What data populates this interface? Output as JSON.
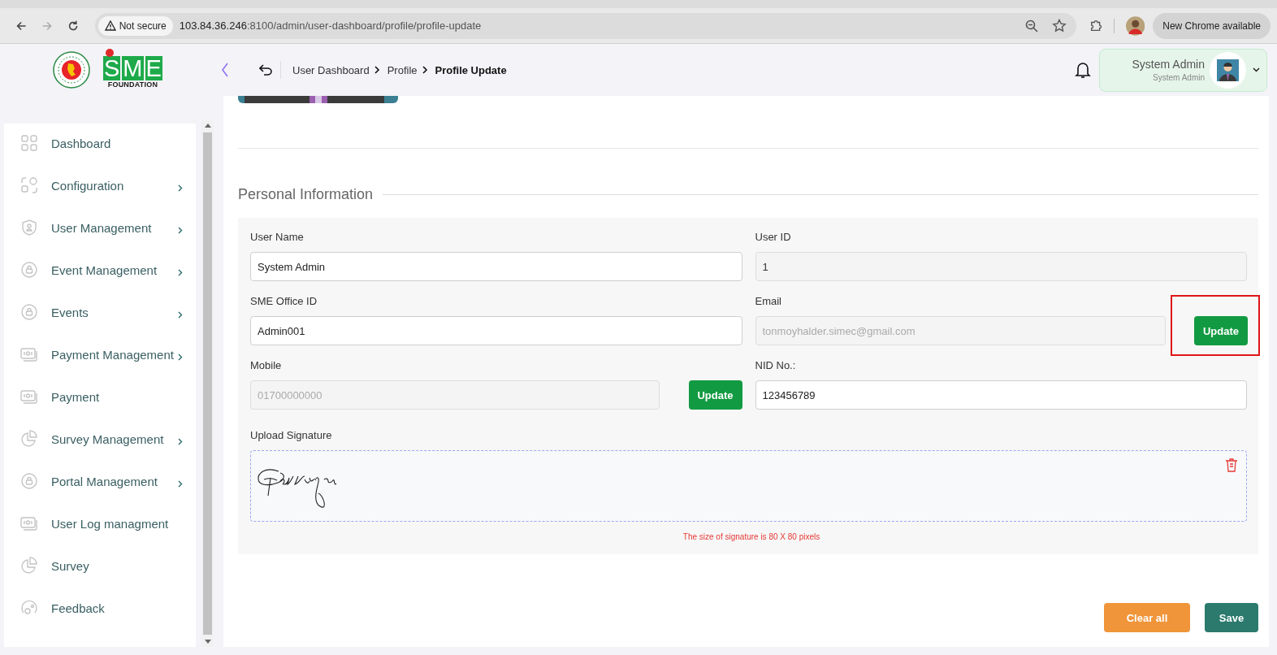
{
  "browser": {
    "security_label": "Not secure",
    "url_host": "103.84.36.246",
    "url_path": ":8100/admin/user-dashboard/profile/profile-update",
    "update_label": "New Chrome available"
  },
  "brand": {
    "mark": "SME",
    "subtitle": "FOUNDATION"
  },
  "header": {
    "breadcrumb": [
      {
        "label": "User Dashboard",
        "current": false
      },
      {
        "label": "Profile",
        "current": false
      },
      {
        "label": "Profile Update",
        "current": true
      }
    ],
    "user": {
      "name": "System Admin",
      "role": "System Admin"
    }
  },
  "sidebar": {
    "items": [
      {
        "label": "Dashboard",
        "has_submenu": false
      },
      {
        "label": "Configuration",
        "has_submenu": true
      },
      {
        "label": "User Management",
        "has_submenu": true
      },
      {
        "label": "Event Management",
        "has_submenu": true
      },
      {
        "label": "Events",
        "has_submenu": true
      },
      {
        "label": "Payment Management",
        "has_submenu": true
      },
      {
        "label": "Payment",
        "has_submenu": false
      },
      {
        "label": "Survey Management",
        "has_submenu": true
      },
      {
        "label": "Portal Management",
        "has_submenu": true
      },
      {
        "label": "User Log managment",
        "has_submenu": false
      },
      {
        "label": "Survey",
        "has_submenu": false
      },
      {
        "label": "Feedback",
        "has_submenu": false
      }
    ]
  },
  "section_title": "Personal Information",
  "fields": [
    {
      "label": "User Name",
      "value": "System Admin",
      "disabled": false
    },
    {
      "label": "User ID",
      "value": "1",
      "disabled": true
    },
    {
      "label": "SME Office ID",
      "value": "Admin001",
      "disabled": false
    },
    {
      "label": "Email",
      "placeholder": "tonmoyhalder.simec@gmail.com",
      "disabled": true,
      "button": {
        "label": "Update",
        "highlighted": true
      }
    },
    {
      "label": "Mobile",
      "placeholder": "01700000000",
      "disabled": true,
      "button": {
        "label": "Update",
        "highlighted": false
      }
    },
    {
      "label": "NID No.:",
      "value": "123456789",
      "disabled": false
    }
  ],
  "signature": {
    "label": "Upload Signature",
    "note": "The size of signature is 80 X 80 pixels"
  },
  "actions": [
    {
      "label": "Clear all",
      "kind": "secondary"
    },
    {
      "label": "Save",
      "kind": "primary"
    }
  ]
}
